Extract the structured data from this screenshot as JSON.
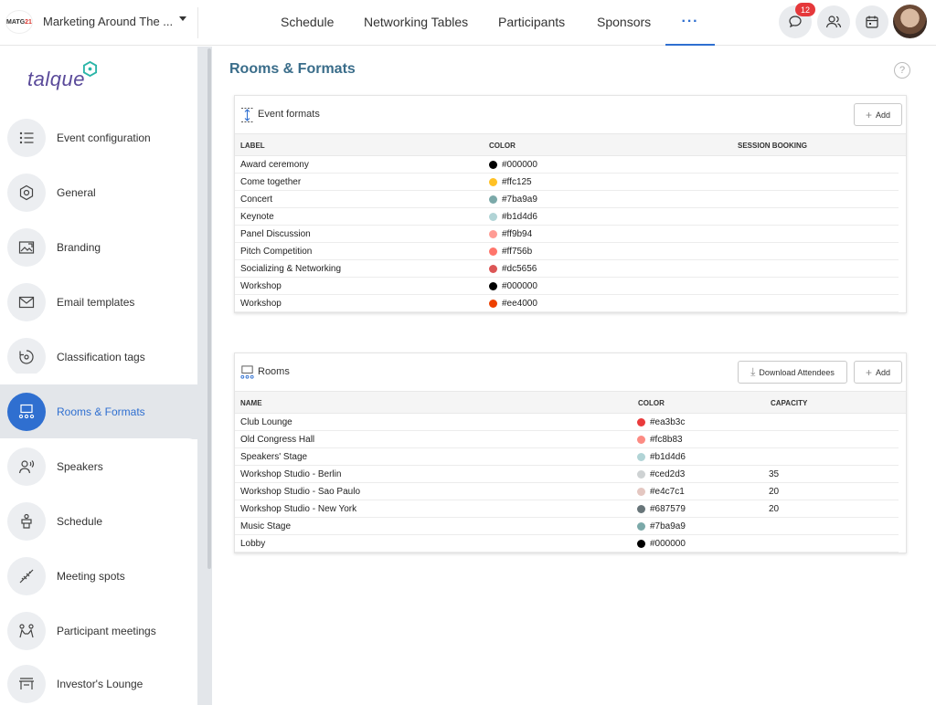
{
  "event": {
    "logo_text_a": "MATG",
    "logo_text_b": "21",
    "name": "Marketing Around The ..."
  },
  "nav": {
    "items": [
      "Schedule",
      "Networking Tables",
      "Participants",
      "Sponsors"
    ],
    "more": "···"
  },
  "header_actions": {
    "chat_badge": "12"
  },
  "brand": {
    "name": "talque"
  },
  "sidebar": {
    "items": [
      {
        "label": "Event configuration",
        "icon": "list-icon"
      },
      {
        "label": "General",
        "icon": "hexagon-icon"
      },
      {
        "label": "Branding",
        "icon": "image-icon"
      },
      {
        "label": "Email templates",
        "icon": "email-icon"
      },
      {
        "label": "Classification tags",
        "icon": "tag-icon"
      },
      {
        "label": "Rooms & Formats",
        "icon": "rooms-icon"
      },
      {
        "label": "Speakers",
        "icon": "speaker-icon"
      },
      {
        "label": "Schedule",
        "icon": "podium-icon"
      },
      {
        "label": "Meeting spots",
        "icon": "pin-icon"
      },
      {
        "label": "Participant meetings",
        "icon": "meeting-icon"
      },
      {
        "label": "Investor's Lounge",
        "icon": "lounge-icon"
      }
    ]
  },
  "main": {
    "title": "Rooms & Formats",
    "help": "?",
    "formats": {
      "title": "Event formats",
      "add_label": "Add",
      "columns": [
        "LABEL",
        "COLOR",
        "SESSION BOOKING"
      ],
      "rows": [
        {
          "label": "Award ceremony",
          "color": "#000000"
        },
        {
          "label": "Come together",
          "color": "#ffc125"
        },
        {
          "label": "Concert",
          "color": "#7ba9a9"
        },
        {
          "label": "Keynote",
          "color": "#b1d4d6"
        },
        {
          "label": "Panel Discussion",
          "color": "#ff9b94"
        },
        {
          "label": "Pitch Competition",
          "color": "#ff756b"
        },
        {
          "label": "Socializing & Networking",
          "color": "#dc5656"
        },
        {
          "label": "Workshop",
          "color": "#000000"
        },
        {
          "label": "Workshop",
          "color": "#ee4000"
        }
      ]
    },
    "rooms": {
      "title": "Rooms",
      "download_label": "Download Attendees",
      "add_label": "Add",
      "columns": [
        "NAME",
        "COLOR",
        "CAPACITY"
      ],
      "rows": [
        {
          "name": "Club Lounge",
          "color": "#ea3b3c",
          "capacity": ""
        },
        {
          "name": "Old Congress Hall",
          "color": "#fc8b83",
          "capacity": ""
        },
        {
          "name": "Speakers' Stage",
          "color": "#b1d4d6",
          "capacity": ""
        },
        {
          "name": "Workshop Studio - Berlin",
          "color": "#ced2d3",
          "capacity": "35"
        },
        {
          "name": "Workshop Studio - Sao Paulo",
          "color": "#e4c7c1",
          "capacity": "20"
        },
        {
          "name": "Workshop Studio - New York",
          "color": "#687579",
          "capacity": "20"
        },
        {
          "name": "Music Stage",
          "color": "#7ba9a9",
          "capacity": ""
        },
        {
          "name": "Lobby",
          "color": "#000000",
          "capacity": ""
        }
      ]
    }
  }
}
